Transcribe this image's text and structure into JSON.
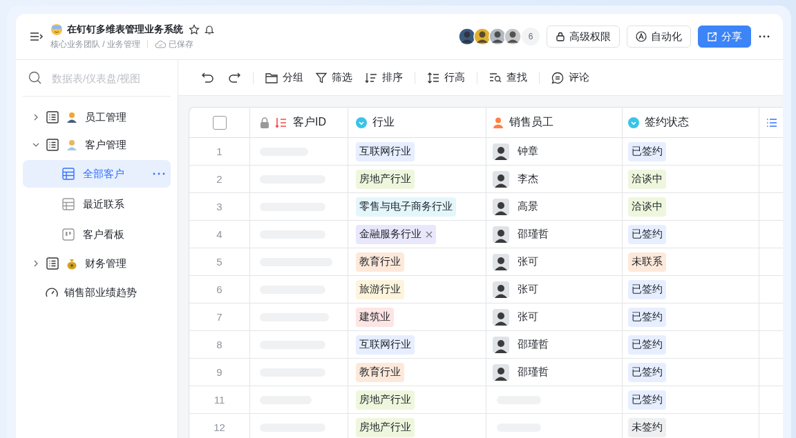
{
  "header": {
    "title": "在钉钉多维表管理业务系统",
    "breadcrumb": "核心业务团队 / 业务管理",
    "save_status": "已保存",
    "member_count": "6",
    "buttons": [
      {
        "label": "高级权限",
        "kind": "lock",
        "primary": false
      },
      {
        "label": "自动化",
        "kind": "auto",
        "primary": false
      },
      {
        "label": "分享",
        "kind": "share",
        "primary": true
      }
    ]
  },
  "sidebar": {
    "search": {
      "placeholder": "数据表/仪表盘/视图"
    },
    "items": [
      {
        "label": "员工管理",
        "kind": "table",
        "expanded": false
      },
      {
        "label": "客户管理",
        "kind": "table",
        "expanded": true,
        "children": [
          {
            "label": "全部客户",
            "kind": "grid",
            "selected": true
          },
          {
            "label": "最近联系",
            "kind": "grid",
            "selected": false
          },
          {
            "label": "客户看板",
            "kind": "kanban",
            "selected": false
          }
        ]
      },
      {
        "label": "财务管理",
        "kind": "table",
        "expanded": false
      },
      {
        "label": "销售部业绩趋势",
        "kind": "dashboard"
      }
    ]
  },
  "toolbar": [
    [
      {
        "kind": "undo"
      },
      {
        "kind": "redo"
      }
    ],
    [
      {
        "kind": "group",
        "label": "分组"
      },
      {
        "kind": "filter",
        "label": "筛选"
      },
      {
        "kind": "sort",
        "label": "排序"
      }
    ],
    [
      {
        "kind": "height",
        "label": "行高"
      }
    ],
    [
      {
        "kind": "find",
        "label": "查找"
      }
    ],
    [
      {
        "kind": "comment",
        "label": "评论"
      }
    ]
  ],
  "table": {
    "columns": [
      {
        "kind": "select",
        "checked": false
      },
      {
        "kind": "autonum",
        "label": "客户ID",
        "locked": true
      },
      {
        "kind": "option",
        "label": "行业"
      },
      {
        "kind": "person",
        "label": "销售员工"
      },
      {
        "kind": "option",
        "label": "签约状态"
      },
      {
        "kind": "list"
      }
    ],
    "rows": [
      {
        "num": "1",
        "industry": {
          "label": "互联网行业",
          "color": "#e6eeff"
        },
        "sales": "钟章",
        "status": {
          "label": "已签约",
          "color": "#e6eeff"
        }
      },
      {
        "num": "2",
        "industry": {
          "label": "房地产行业",
          "color": "#eef7dd"
        },
        "sales": "李杰",
        "status": {
          "label": "洽谈中",
          "color": "#eef7dd"
        }
      },
      {
        "num": "3",
        "industry": {
          "label": "零售与电子商务行业",
          "color": "#e3f6fb"
        },
        "sales": "高景",
        "status": {
          "label": "洽谈中",
          "color": "#eef7dd"
        }
      },
      {
        "num": "4",
        "industry": {
          "label": "金融服务行业",
          "color": "#e8e7fb",
          "removable": true
        },
        "sales": "邵瑾哲",
        "status": {
          "label": "已签约",
          "color": "#e6eeff"
        }
      },
      {
        "num": "5",
        "industry": {
          "label": "教育行业",
          "color": "#fde9da"
        },
        "sales": "张可",
        "status": {
          "label": "未联系",
          "color": "#fde9da"
        }
      },
      {
        "num": "6",
        "industry": {
          "label": "旅游行业",
          "color": "#fdf4dc"
        },
        "sales": "张可",
        "status": {
          "label": "已签约",
          "color": "#e6eeff"
        }
      },
      {
        "num": "7",
        "industry": {
          "label": "建筑业",
          "color": "#fde5e4"
        },
        "sales": "张可",
        "status": {
          "label": "已签约",
          "color": "#e6eeff"
        }
      },
      {
        "num": "8",
        "industry": {
          "label": "互联网行业",
          "color": "#e6eeff"
        },
        "sales": "邵瑾哲",
        "status": {
          "label": "已签约",
          "color": "#e6eeff"
        }
      },
      {
        "num": "9",
        "industry": {
          "label": "教育行业",
          "color": "#fde9da"
        },
        "sales": "邵瑾哲",
        "status": {
          "label": "已签约",
          "color": "#e6eeff"
        }
      },
      {
        "num": "11",
        "industry": {
          "label": "房地产行业",
          "color": "#eef7dd"
        },
        "status": {
          "label": "已签约",
          "color": "#e6eeff"
        }
      },
      {
        "num": "12",
        "industry": {
          "label": "房地产行业",
          "color": "#eef7dd"
        },
        "status": {
          "label": "未签约",
          "color": "#eeeff1"
        }
      }
    ]
  }
}
